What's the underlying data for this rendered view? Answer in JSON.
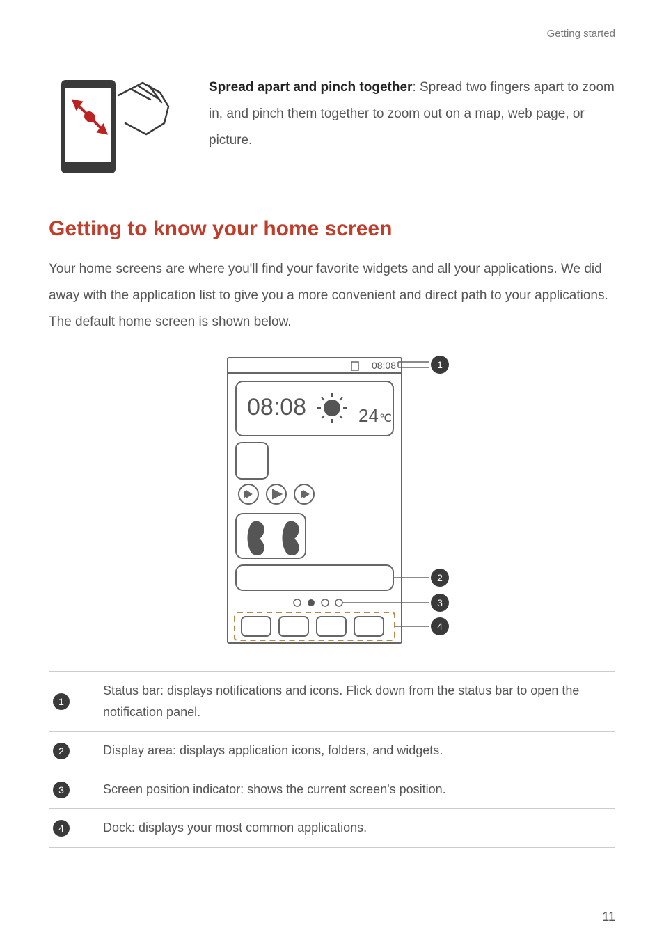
{
  "header": {
    "section_label": "Getting started"
  },
  "gesture": {
    "title": "Spread apart and pinch together",
    "text": ": Spread two fingers apart to zoom in, and pinch them together to zoom out on a map, web page, or picture."
  },
  "section_heading": "Getting to know your home screen",
  "intro": "Your home screens are where you'll find your favorite widgets and all your applications. We did away with the application list to give you a more convenient and direct path to your applications. The default home screen is shown below.",
  "diagram": {
    "status_time": "08:08",
    "clock_time": "08:08",
    "weather_deg": "24",
    "weather_unit": "℃",
    "callout1": "1",
    "callout2": "2",
    "callout3": "3",
    "callout4": "4"
  },
  "legend": {
    "rows": [
      {
        "n": "1",
        "text": "Status bar: displays notifications and icons. Flick down from the status bar to open the notification panel."
      },
      {
        "n": "2",
        "text": "Display area: displays application icons, folders, and widgets."
      },
      {
        "n": "3",
        "text": "Screen position indicator: shows the current screen's position."
      },
      {
        "n": "4",
        "text": "Dock: displays your most common applications."
      }
    ]
  },
  "page_number": "11"
}
